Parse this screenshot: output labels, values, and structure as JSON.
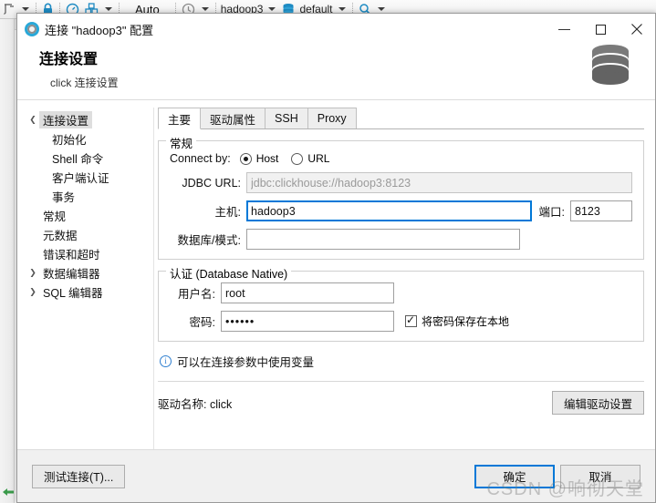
{
  "ide": {
    "toolbar": {
      "icons": [
        "script-icon",
        "lock-icon",
        "gauge-icon",
        "packages-icon"
      ],
      "auto_label": "Auto",
      "history_icon": "history-clock-icon",
      "connection_label": "hadoop3",
      "database_icon": "database-icon",
      "database_label": "default",
      "search_icon": "search-icon"
    }
  },
  "dialog": {
    "title": "连接 \"hadoop3\" 配置",
    "title_icon": "connection-icon",
    "window_controls": {
      "minimize": "—",
      "maximize": "☐",
      "close": "✕"
    },
    "header": {
      "title": "连接设置",
      "subtitle": "click 连接设置",
      "logo_icon": "database-cylinder-icon"
    },
    "tree": {
      "items": [
        {
          "label": "连接设置",
          "indent": 0,
          "twisty": "expanded",
          "selected": true
        },
        {
          "label": "初始化",
          "indent": 2,
          "twisty": "none",
          "selected": false
        },
        {
          "label": "Shell 命令",
          "indent": 2,
          "twisty": "none",
          "selected": false
        },
        {
          "label": "客户端认证",
          "indent": 2,
          "twisty": "none",
          "selected": false
        },
        {
          "label": "事务",
          "indent": 2,
          "twisty": "none",
          "selected": false
        },
        {
          "label": "常规",
          "indent": 1,
          "twisty": "none",
          "selected": false
        },
        {
          "label": "元数据",
          "indent": 1,
          "twisty": "none",
          "selected": false
        },
        {
          "label": "错误和超时",
          "indent": 1,
          "twisty": "none",
          "selected": false
        },
        {
          "label": "数据编辑器",
          "indent": 0,
          "twisty": "collapsed",
          "selected": false
        },
        {
          "label": "SQL 编辑器",
          "indent": 0,
          "twisty": "collapsed",
          "selected": false
        }
      ]
    },
    "tabs": [
      {
        "label": "主要",
        "active": true
      },
      {
        "label": "驱动属性",
        "active": false
      },
      {
        "label": "SSH",
        "active": false
      },
      {
        "label": "Proxy",
        "active": false
      }
    ],
    "general_group": {
      "legend": "常规",
      "connect_by_label": "Connect by:",
      "radio_host_label": "Host",
      "radio_host_selected": true,
      "radio_url_label": "URL",
      "radio_url_selected": false,
      "jdbc_url_label": "JDBC URL:",
      "jdbc_url_value": "jdbc:clickhouse://hadoop3:8123",
      "host_label": "主机:",
      "host_value": "hadoop3",
      "port_label": "端口:",
      "port_value": "8123",
      "database_label": "数据库/模式:",
      "database_value": "",
      "database_placeholder": ""
    },
    "auth_group": {
      "legend": "认证 (Database Native)",
      "username_label": "用户名:",
      "username_value": "root",
      "password_label": "密码:",
      "password_value": "••••••",
      "save_password_label": "将密码保存在本地",
      "save_password_checked": true
    },
    "info": {
      "icon": "info-icon",
      "text": "可以在连接参数中使用变量"
    },
    "driver": {
      "label": "驱动名称: click",
      "edit_button": "编辑驱动设置"
    },
    "footer": {
      "test_connection": "测试连接(T)...",
      "ok": "确定",
      "cancel": "取消"
    },
    "watermark": "CSDN @响彻天堂"
  },
  "colors": {
    "accent": "#0078d7",
    "icon_blue": "#1e8bc3",
    "dialog_bg": "#ffffff",
    "footer_bg": "#f0f0f0"
  }
}
